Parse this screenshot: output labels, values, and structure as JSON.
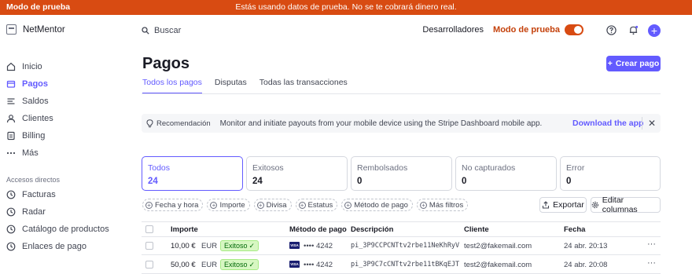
{
  "banner": {
    "tag": "Modo de prueba",
    "message": "Estás usando datos de prueba. No se te cobrará dinero real."
  },
  "brand": {
    "name": "NetMentor"
  },
  "search": {
    "placeholder": "Buscar"
  },
  "topbar": {
    "developers": "Desarrolladores",
    "test_mode": "Modo de prueba",
    "test_mode_on": true,
    "icons": [
      "help-icon",
      "bell-icon",
      "gear-icon",
      "plus-icon"
    ]
  },
  "sidebar": {
    "items": [
      {
        "label": "Inicio",
        "icon": "home-icon"
      },
      {
        "label": "Pagos",
        "icon": "payments-icon",
        "active": true
      },
      {
        "label": "Saldos",
        "icon": "balances-icon"
      },
      {
        "label": "Clientes",
        "icon": "user-icon"
      },
      {
        "label": "Billing",
        "icon": "billing-icon"
      },
      {
        "label": "Más",
        "icon": "more-icon"
      }
    ],
    "section_title": "Accesos directos",
    "shortcuts": [
      {
        "label": "Facturas",
        "icon": "clock-icon"
      },
      {
        "label": "Radar",
        "icon": "clock-icon"
      },
      {
        "label": "Catálogo de productos",
        "icon": "clock-icon"
      },
      {
        "label": "Enlaces de pago",
        "icon": "clock-icon"
      }
    ]
  },
  "page": {
    "title": "Pagos",
    "create_button": "Crear pago",
    "tabs": [
      {
        "label": "Todos los pagos",
        "active": true
      },
      {
        "label": "Disputas"
      },
      {
        "label": "Todas las transacciones"
      }
    ]
  },
  "recommendation": {
    "tag": "Recomendación",
    "message": "Monitor and initiate payouts from your mobile device using the Stripe Dashboard mobile app.",
    "link": "Download the app"
  },
  "status_cards": [
    {
      "label": "Todos",
      "count": "24",
      "active": true
    },
    {
      "label": "Exitosos",
      "count": "24"
    },
    {
      "label": "Rembolsados",
      "count": "0"
    },
    {
      "label": "No capturados",
      "count": "0"
    },
    {
      "label": "Error",
      "count": "0"
    }
  ],
  "filters": [
    "Fecha y hora",
    "Importe",
    "Divisa",
    "Estatus",
    "Método de pago",
    "Más filtros"
  ],
  "actions": {
    "export": "Exportar",
    "edit_columns": "Editar columnas"
  },
  "table": {
    "columns": [
      "Importe",
      "Método de pago",
      "Descripción",
      "Cliente",
      "Fecha"
    ],
    "rows": [
      {
        "amount": "10,00 €",
        "currency": "EUR",
        "status": "Exitoso",
        "card_brand": "VISA",
        "last4": "•••• 4242",
        "description": "pi_3P9CCPCNTtv2rbe11NeKhRyV",
        "customer": "test2@fakemail.com",
        "date": "24 abr. 20:13"
      },
      {
        "amount": "50,00 €",
        "currency": "EUR",
        "status": "Exitoso",
        "card_brand": "VISA",
        "last4": "•••• 4242",
        "description": "pi_3P9C7cCNTtv2rbe11tBKqEJT",
        "customer": "test2@fakemail.com",
        "date": "24 abr. 20:08"
      }
    ]
  },
  "colors": {
    "accent": "#635bff",
    "test_banner": "#d84b12",
    "success_bg": "#d7f7c2",
    "success_text": "#006908"
  }
}
